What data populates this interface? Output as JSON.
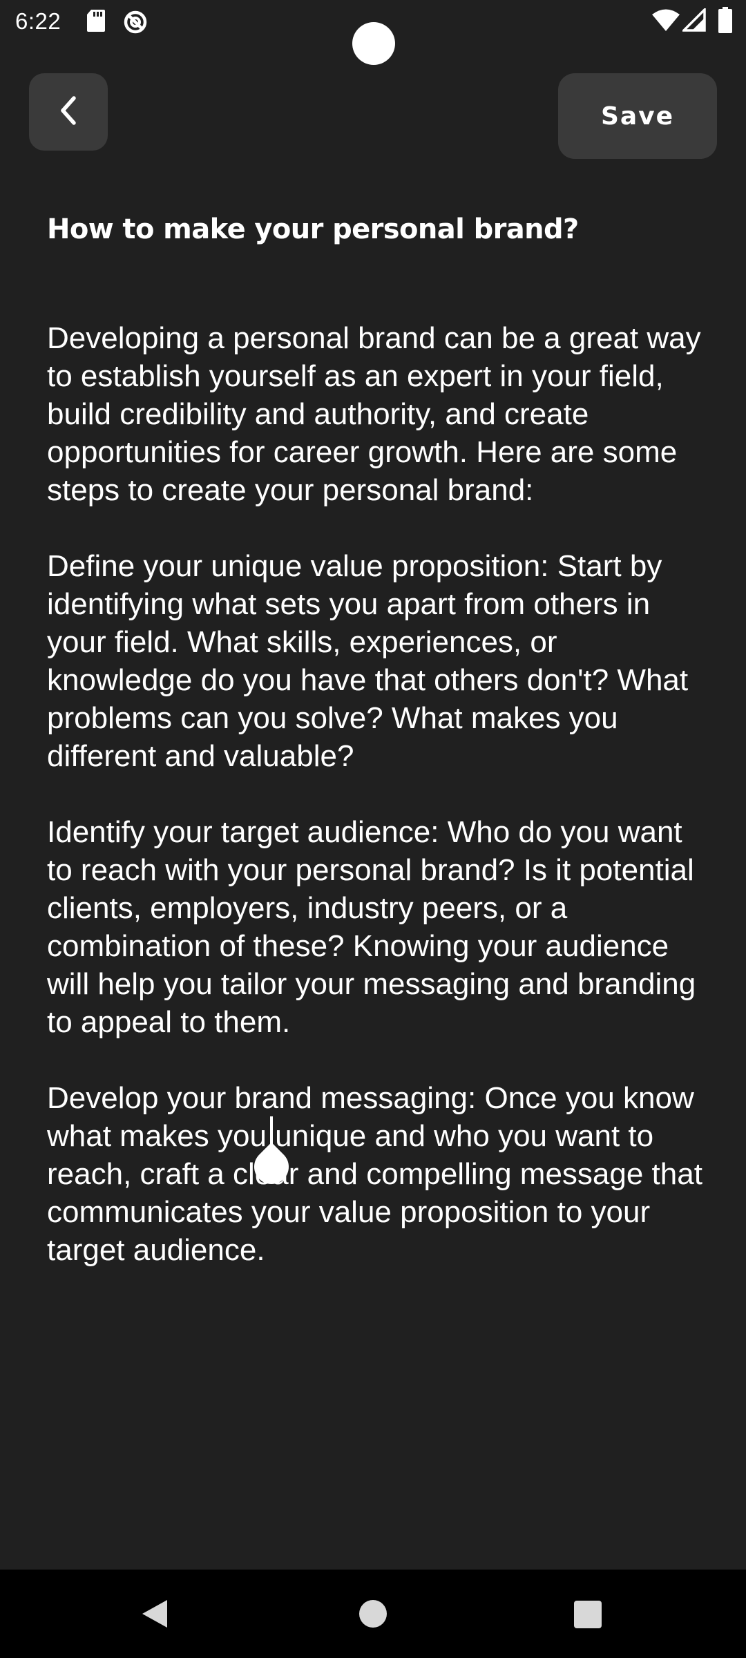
{
  "status_bar": {
    "time": "6:22",
    "icons": [
      "sd-card-icon",
      "do-not-disturb-icon",
      "wifi-icon",
      "signal-icon",
      "battery-icon"
    ]
  },
  "toolbar": {
    "back_icon": "chevron-left-icon",
    "save_label": "Save"
  },
  "note": {
    "title": "How to make your personal brand?",
    "paragraphs": [
      "Developing a personal brand can be a great way to establish yourself as an expert in your field, build credibility and authority, and create opportunities for career growth. Here are some steps to create your personal brand:",
      "Define your unique value proposition: Start by identifying what sets you apart from others in your field. What skills, experiences, or knowledge do you have that others don't? What problems can you solve? What makes you different and valuable?",
      "Identify your target audience: Who do you want to reach with your personal brand? Is it potential clients, employers, industry peers, or a combination of these? Knowing your audience will help you tailor your messaging and branding to appeal to them.",
      "Develop your brand messaging: Once you know what makes you unique and who you want to reach, craft a clear and compelling message that communicates your value proposition to your target audience."
    ]
  },
  "colors": {
    "background": "#202020",
    "button": "#3a3a3a",
    "text": "#ffffff",
    "nav_bar": "#000000"
  },
  "nav_bar": {
    "buttons": [
      "nav-back-icon",
      "nav-home-icon",
      "nav-recents-icon"
    ]
  }
}
